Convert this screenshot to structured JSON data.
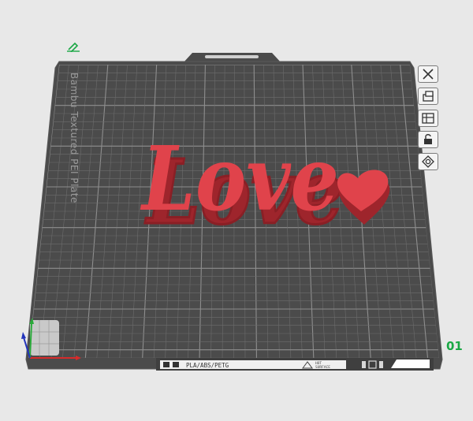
{
  "plate": {
    "name_label": "Bambu Textured PEI Plate",
    "filament_label": "PLA/ABS/PETG",
    "hot_surface_line1": "HOT",
    "hot_surface_line2": "SURFACE",
    "number": "01"
  },
  "model": {
    "text": "Love",
    "color": "#e0434b",
    "shadow_color": "#a82a30"
  },
  "colors": {
    "background": "#e8e8e8",
    "plate": "#4b4b4b",
    "grid": "#7c7c7c",
    "accent_green": "#1aa845"
  },
  "toolbar": [
    {
      "icon": "close-icon"
    },
    {
      "icon": "auto-orient-icon"
    },
    {
      "icon": "arrange-icon"
    },
    {
      "icon": "lock-icon"
    },
    {
      "icon": "plate-settings-icon"
    }
  ]
}
